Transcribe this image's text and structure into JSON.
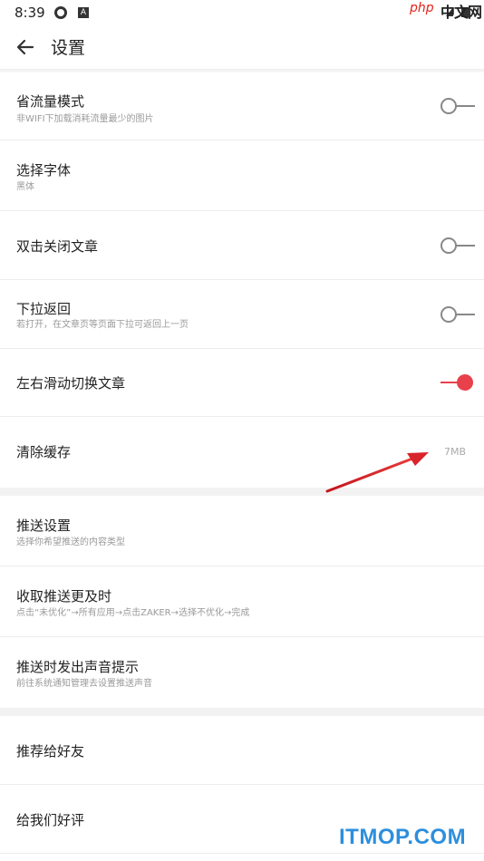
{
  "status_bar": {
    "time": "8:39",
    "icon_b": "A"
  },
  "watermark_top": {
    "php": "php",
    "cn": "中文网"
  },
  "header": {
    "title": "设置"
  },
  "settings": [
    {
      "title": "省流量模式",
      "subtitle": "非WIFI下加载消耗流量最少的图片",
      "toggle": "off"
    },
    {
      "title": "选择字体",
      "subtitle": "黑体"
    },
    {
      "title": "双击关闭文章",
      "toggle": "off"
    },
    {
      "title": "下拉返回",
      "subtitle": "若打开，在文章页等页面下拉可返回上一页",
      "toggle": "off"
    },
    {
      "title": "左右滑动切换文章",
      "toggle": "on"
    },
    {
      "title": "清除缓存",
      "value": "7MB"
    }
  ],
  "push": [
    {
      "title": "推送设置",
      "subtitle": "选择你希望推送的内容类型"
    },
    {
      "title": "收取推送更及时",
      "subtitle": "点击“未优化”→所有应用→点击ZAKER→选择不优化→完成"
    },
    {
      "title": "推送时发出声音提示",
      "subtitle": "前往系统通知管理去设置推送声音"
    }
  ],
  "other": [
    {
      "title": "推荐给好友"
    },
    {
      "title": "给我们好评"
    }
  ],
  "watermark": "ITMOP.COM",
  "colors": {
    "accent": "#e8414b",
    "annotation_arrow": "#d9232a",
    "watermark": "#2d8fdd"
  }
}
